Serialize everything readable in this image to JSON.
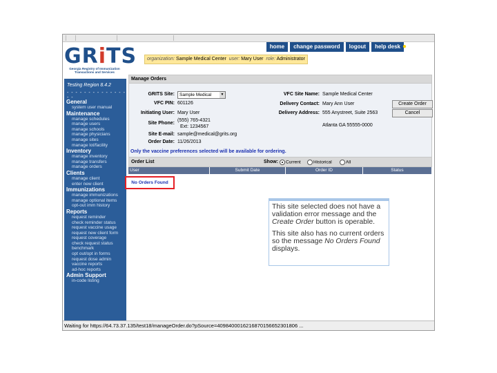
{
  "nav": [
    "home",
    "change password",
    "logout",
    "help desk"
  ],
  "logo": {
    "word_g": "GR",
    "word_i": "i",
    "word_ts": "TS",
    "sub1": "Georgia Registry of Immunization",
    "sub2": "Transactions and Services"
  },
  "userbar": {
    "org_label": "organization:",
    "org": "Sample Medical Center",
    "user_label": "user:",
    "user": "Mary User",
    "role_label": "role:",
    "role": "Administrator"
  },
  "sidebar": {
    "region": "Testing Region 8.4.2",
    "dots": "- - - - - - - - - - - - - - - -",
    "menu": [
      {
        "category": "General",
        "items": [
          "system user manual"
        ]
      },
      {
        "category": "Maintenance",
        "items": [
          "manage schedules",
          "manage users",
          "manage schools",
          "manage physicians",
          "manage sites",
          "manage lot/facility"
        ]
      },
      {
        "category": "Inventory",
        "items": [
          "manage inventory",
          "manage transfers",
          "manage orders"
        ]
      },
      {
        "category": "Clients",
        "items": [
          "manage client",
          "enter new client"
        ]
      },
      {
        "category": "Immunizations",
        "items": [
          "manage immunizations",
          "manage optional items",
          "opt-out imm history"
        ]
      },
      {
        "category": "Reports",
        "items": [
          "request reminder",
          "check reminder status",
          "request vaccine usage",
          "request new client form",
          "request coverage",
          "check request status",
          "benchmark",
          "opt out/opt in forms",
          "request dose admin",
          "vaccine reports",
          "ad-hoc reports"
        ]
      },
      {
        "category": "Admin Support",
        "items": [
          "in-code listing"
        ]
      }
    ]
  },
  "manage_orders": {
    "title": "Manage Orders",
    "grits_site_label": "GRITS Site:",
    "grits_site_value": "Sample Medical",
    "vfc_pin_label": "VFC PIN:",
    "vfc_pin": "601126",
    "initiating_user_label": "Initiating User:",
    "initiating_user": "Mary User",
    "site_phone_label": "Site Phone:",
    "site_phone": "(555) 765-4321",
    "site_phone_ext": "Ext: 1234567",
    "site_email_label": "Site E-mail:",
    "site_email": "sample@medical@grits.org",
    "order_date_label": "Order Date:",
    "order_date": "11/26/2013",
    "vfc_site_name_label": "VFC Site Name:",
    "vfc_site_name": "Sample Medical Center",
    "delivery_contact_label": "Delivery Contact:",
    "delivery_contact": "Mary Ann User",
    "delivery_address_label": "Delivery Address:",
    "delivery_address_1": "555 Anystreet, Suite 2563",
    "delivery_address_2": "Atlanta GA 55555-0000",
    "create_order": "Create Order",
    "cancel": "Cancel",
    "note": "Only the vaccine preferences selected will be available for ordering."
  },
  "order_list": {
    "title": "Order List",
    "show_label": "Show:",
    "filters": [
      {
        "label": "Current",
        "selected": true
      },
      {
        "label": "Historical",
        "selected": false
      },
      {
        "label": "All",
        "selected": false
      }
    ],
    "columns": [
      "User",
      "Submit Date",
      "Order ID",
      "Status"
    ],
    "empty_message": "No Orders Found"
  },
  "callout": {
    "p1_a": "This site selected does not have a validation error message and the ",
    "p1_em": "Create Order",
    "p1_b": " button is operable.",
    "p2_a": "This site also has no current orders so the message ",
    "p2_em": "No Orders Found",
    "p2_b": " displays."
  },
  "status_bar": "Waiting for https://64.73.37.135/test18/manageOrder.do?pSource=4098400016216870156652301806 ..."
}
